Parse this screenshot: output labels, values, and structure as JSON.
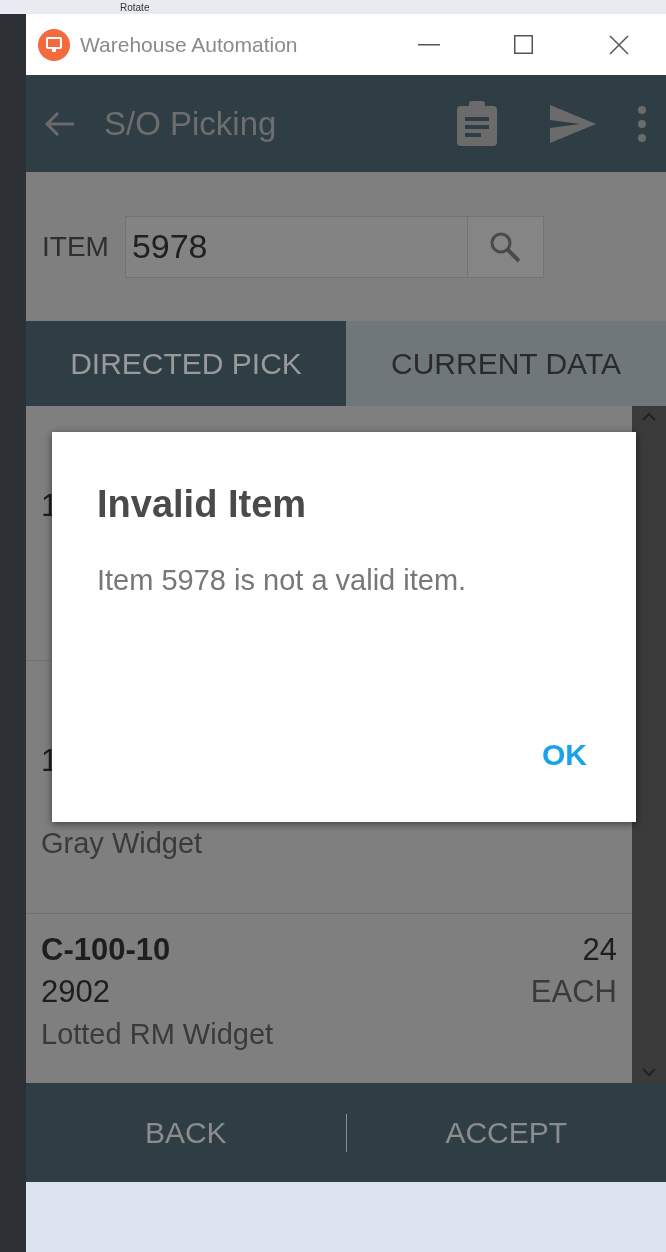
{
  "background_toolbar": {
    "label": "Rotate"
  },
  "window": {
    "title": "Warehouse Automation"
  },
  "header": {
    "title": "S/O Picking"
  },
  "search": {
    "label": "ITEM",
    "value": "5978"
  },
  "tabs": [
    {
      "label": "DIRECTED PICK",
      "selected": true
    },
    {
      "label": "CURRENT DATA",
      "selected": false
    }
  ],
  "picks": [
    {
      "location": "1"
    },
    {
      "location": "1",
      "description": "Gray Widget"
    },
    {
      "item": "C-100-10",
      "quantity": "24",
      "location": "2902",
      "unit": "EACH",
      "description": "Lotted RM Widget"
    }
  ],
  "dialog": {
    "title": "Invalid Item",
    "message": "Item 5978 is not a valid item.",
    "button": "OK"
  },
  "footer": {
    "buttons": [
      "BACK",
      "ACCEPT"
    ]
  }
}
